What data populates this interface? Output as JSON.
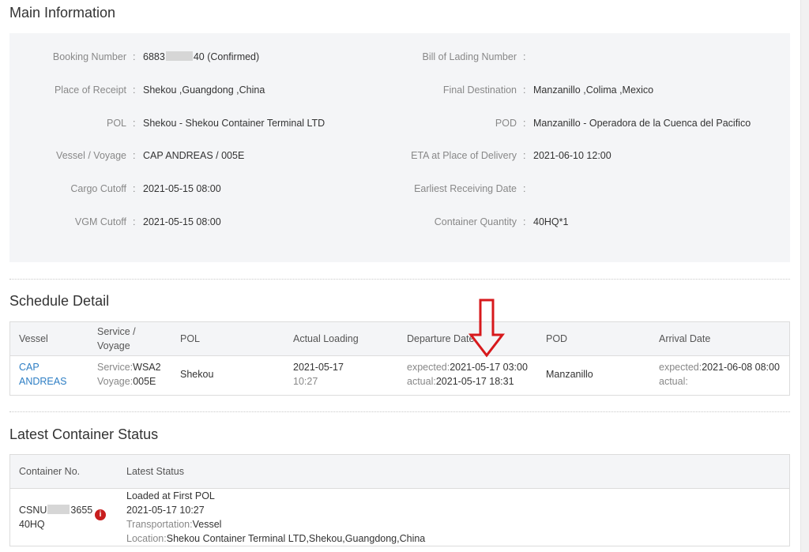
{
  "main_information": {
    "title": "Main Information",
    "left": [
      {
        "label": "Booking Number",
        "value_prefix": "6883",
        "value_suffix": "40 (Confirmed)"
      },
      {
        "label": "Place of Receipt",
        "value": "Shekou ,Guangdong ,China"
      },
      {
        "label": "POL",
        "value": "Shekou - Shekou Container Terminal LTD"
      },
      {
        "label": "Vessel / Voyage",
        "value": "CAP ANDREAS / 005E"
      },
      {
        "label": "Cargo Cutoff",
        "value": "2021-05-15 08:00"
      },
      {
        "label": "VGM Cutoff",
        "value": "2021-05-15 08:00"
      }
    ],
    "right": [
      {
        "label": "Bill of Lading Number",
        "value": ""
      },
      {
        "label": "Final Destination",
        "value": "Manzanillo ,Colima ,Mexico"
      },
      {
        "label": "POD",
        "value": "Manzanillo - Operadora de la Cuenca del Pacifico"
      },
      {
        "label": "ETA at Place of Delivery",
        "value": "2021-06-10 12:00"
      },
      {
        "label": "Earliest Receiving Date",
        "value": ""
      },
      {
        "label": "Container Quantity",
        "value": "40HQ*1"
      }
    ],
    "colon": ":"
  },
  "schedule_detail": {
    "title": "Schedule Detail",
    "headers": {
      "vessel": "Vessel",
      "service_line1": "Service /",
      "service_line2": "Voyage",
      "pol": "POL",
      "actual_loading": "Actual Loading",
      "departure_date": "Departure Date",
      "pod": "POD",
      "arrival_date": "Arrival Date"
    },
    "row": {
      "vessel_line1": "CAP",
      "vessel_line2": "ANDREAS",
      "service_label": "Service:",
      "service_value": "WSA2",
      "voyage_label": "Voyage:",
      "voyage_value": "005E",
      "pol": "Shekou",
      "loading_date": "2021-05-17",
      "loading_time": "10:27",
      "dep_expected_label": "expected:",
      "dep_expected_value": "2021-05-17 03:00",
      "dep_actual_label": "actual:",
      "dep_actual_value": "2021-05-17 18:31",
      "pod": "Manzanillo",
      "arr_expected_label": "expected:",
      "arr_expected_value": "2021-06-08 08:00",
      "arr_actual_label": "actual:",
      "arr_actual_value": ""
    }
  },
  "container_status": {
    "title": "Latest Container Status",
    "headers": {
      "container_no": "Container No.",
      "latest_status": "Latest Status"
    },
    "row": {
      "container_prefix": "CSNU",
      "container_suffix": "3655",
      "container_type": "40HQ",
      "info_icon": "i",
      "status": "Loaded at First POL",
      "datetime": "2021-05-17 10:27",
      "transport_label": "Transportation:",
      "transport_value": "Vessel",
      "location_label": "Location:",
      "location_value": "Shekou Container Terminal LTD,Shekou,Guangdong,China"
    }
  },
  "colors": {
    "accent_link": "#2d7ec4",
    "annotation_arrow": "#d7191c",
    "info_badge": "#c81e1e"
  }
}
